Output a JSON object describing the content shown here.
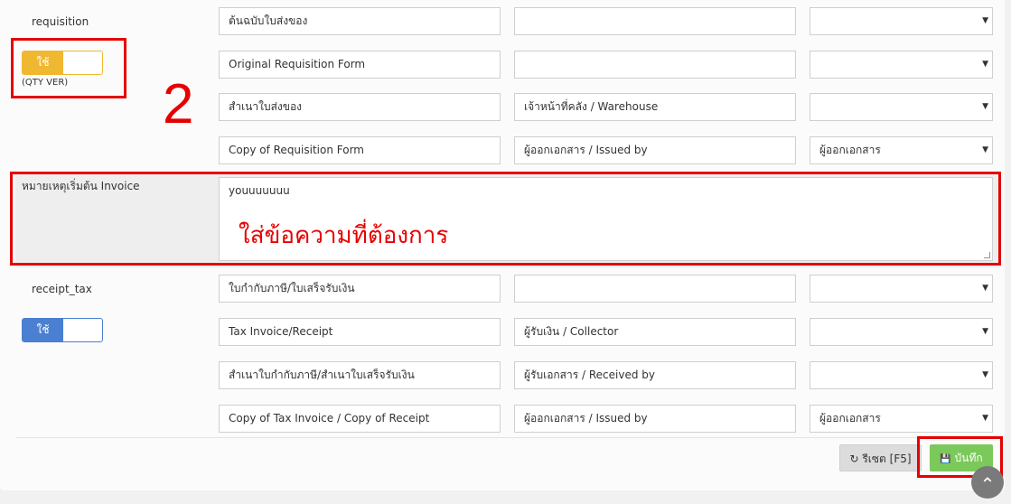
{
  "requisition": {
    "label": "requisition",
    "toggle_label": "ใช้",
    "qty_ver": "(QTY VER)",
    "rows": [
      {
        "title": "ต้นฉบับใบส่งของ",
        "signer": "",
        "select": ""
      },
      {
        "title": "Original Requisition Form",
        "signer": "",
        "select": ""
      },
      {
        "title": "สำเนาใบส่งของ",
        "signer": "เจ้าหน้าที่คลัง / Warehouse",
        "select": ""
      },
      {
        "title": "Copy of Requisition Form",
        "signer": "ผู้ออกเอกสาร / Issued by",
        "select": "ผู้ออกเอกสาร"
      }
    ]
  },
  "invoice_note": {
    "label": "หมายเหตุเริ่มต้น Invoice",
    "value": "youuuuuuu",
    "annotation": "ใส่ข้อความที่ต้องการ"
  },
  "annotation_number": "2",
  "receipt_tax": {
    "label": "receipt_tax",
    "toggle_label": "ใช้",
    "rows": [
      {
        "title": "ใบกำกับภาษี/ใบเสร็จรับเงิน",
        "signer": "",
        "select": ""
      },
      {
        "title": "Tax Invoice/Receipt",
        "signer": "ผู้รับเงิน / Collector",
        "select": ""
      },
      {
        "title": "สำเนาใบกำกับภาษี/สำเนาใบเสร็จรับเงิน",
        "signer": "ผู้รับเอกสาร / Received by",
        "select": ""
      },
      {
        "title": "Copy of Tax Invoice / Copy of Receipt",
        "signer": "ผู้ออกเอกสาร / Issued by",
        "select": "ผู้ออกเอกสาร"
      }
    ]
  },
  "footer": {
    "reset_label": "รีเซต [F5]",
    "save_label": "บันทึก"
  },
  "icons": {
    "caret": "▼",
    "refresh": "↻",
    "save": "💾",
    "scroll_top": "⌃"
  },
  "colors": {
    "toggle_yellow": "#f0b730",
    "toggle_blue": "#4a7fd1",
    "annotation_red": "#e60000",
    "save_green": "#7bc95a"
  }
}
